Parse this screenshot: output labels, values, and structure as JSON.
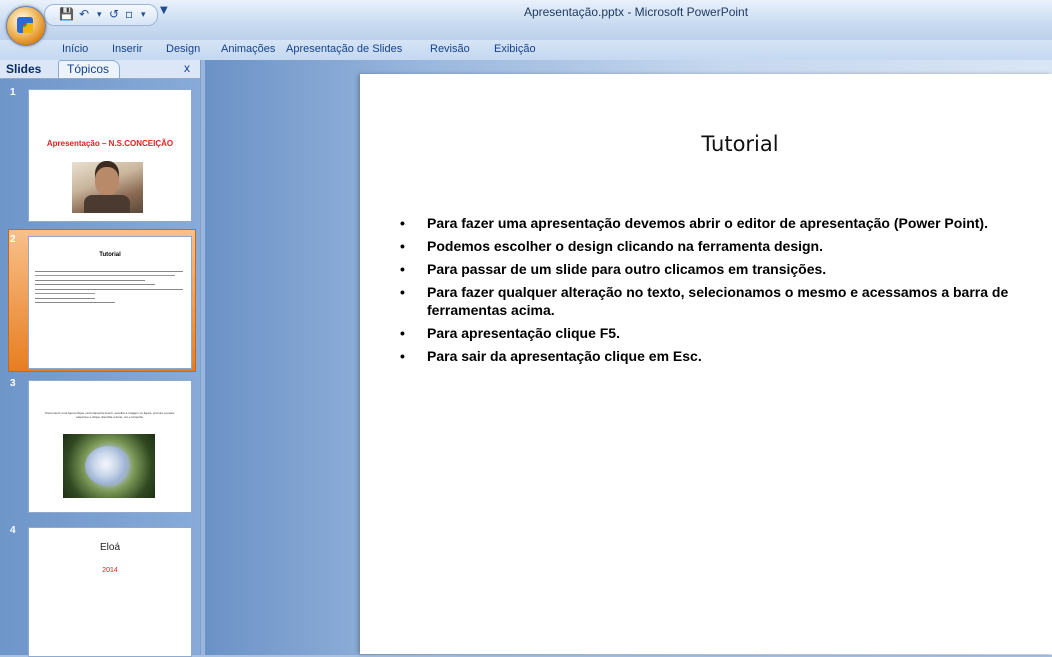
{
  "window": {
    "title": "Apresentação.pptx - Microsoft PowerPoint"
  },
  "quick_access": {
    "icons": [
      "save-icon",
      "undo-icon",
      "redo-icon",
      "slideshow-icon",
      "customize-icon"
    ]
  },
  "menu": [
    "Início",
    "Inserir",
    "Design",
    "Animações",
    "Apresentação de Slides",
    "Revisão",
    "Exibição"
  ],
  "left_pane": {
    "tabs": [
      "Slides",
      "Tópicos"
    ],
    "close": "x",
    "thumbnails": [
      {
        "number": "1",
        "title": "Apresentação – N.S.CONCEIÇÃO"
      },
      {
        "number": "2",
        "title": "Tutorial"
      },
      {
        "number": "3",
        "text": "Para inserir uma figura clique na ferramenta Inserir, escolha a imagem ou figura, procure a pasta, selecione e clique. Escolha a fonte, cor e tamanho."
      },
      {
        "number": "4",
        "title": "Eloá",
        "subtitle": "2014"
      }
    ]
  },
  "slide": {
    "title": "Tutorial",
    "bullets": [
      "Para fazer uma apresentação devemos abrir o editor de apresentação (Power Point).",
      "Podemos escolher o design clicando na ferramenta design.",
      "Para passar de um slide para outro clicamos em transições.",
      "Para fazer qualquer alteração no texto, selecionamos o mesmo e acessamos a barra de ferramentas acima.",
      "Para apresentação clique F5.",
      "Para sair da apresentação clique em Esc."
    ]
  },
  "colors": {
    "accent_selection": "#e77e20",
    "thumb_title_red": "#e02020",
    "ribbon_text": "#15428b"
  }
}
